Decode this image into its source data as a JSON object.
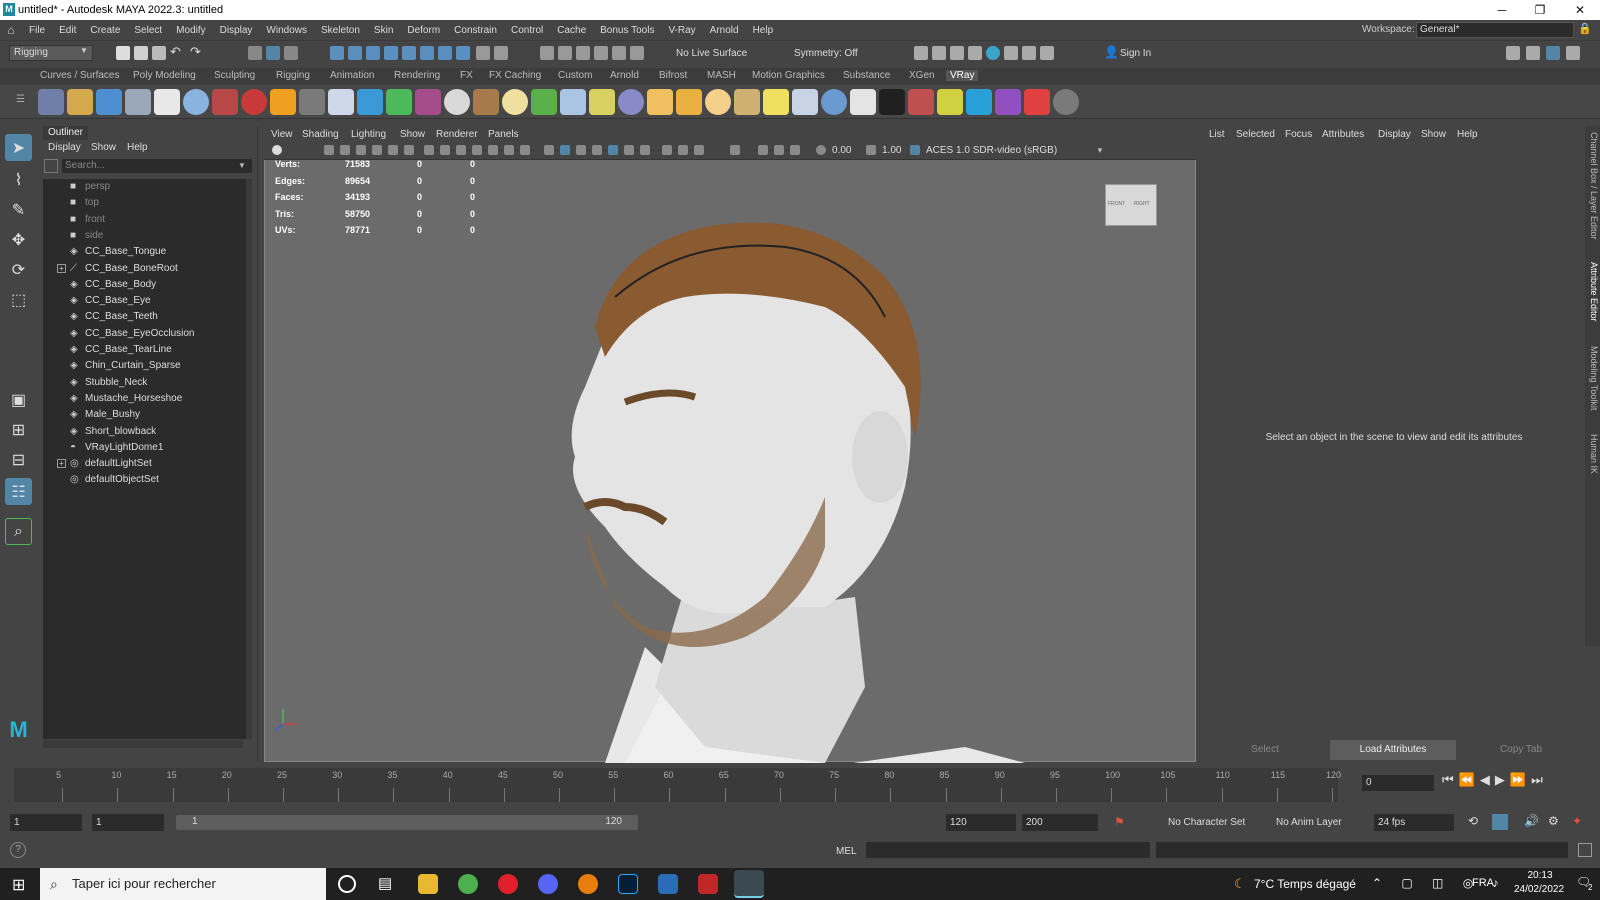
{
  "window": {
    "title": "untitled* - Autodesk MAYA 2022.3: untitled",
    "minimize": "─",
    "maximize": "❐",
    "close": "✕",
    "logo": "M"
  },
  "menubar": {
    "items": [
      "File",
      "Edit",
      "Create",
      "Select",
      "Modify",
      "Display",
      "Windows",
      "Skeleton",
      "Skin",
      "Deform",
      "Constrain",
      "Control",
      "Cache",
      "Bonus Tools",
      "V-Ray",
      "Arnold",
      "Help"
    ],
    "workspace_label": "Workspace:",
    "workspace_value": "General*"
  },
  "statusline": {
    "mode": "Rigging",
    "live_surface": "No Live Surface",
    "symmetry": "Symmetry: Off",
    "sign_in": "Sign In"
  },
  "shelf": {
    "tabs": [
      "Curves / Surfaces",
      "Poly Modeling",
      "Sculpting",
      "Rigging",
      "Animation",
      "Rendering",
      "FX",
      "FX Caching",
      "Custom",
      "Arnold",
      "Bifrost",
      "MASH",
      "Motion Graphics",
      "Substance",
      "XGen",
      "VRay"
    ],
    "active_tab": "VRay"
  },
  "outliner": {
    "title": "Outliner",
    "menu": [
      "Display",
      "Show",
      "Help"
    ],
    "search_placeholder": "Search...",
    "items": [
      {
        "label": "persp",
        "icon": "camera-icon",
        "dim": true
      },
      {
        "label": "top",
        "icon": "camera-icon",
        "dim": true
      },
      {
        "label": "front",
        "icon": "camera-icon",
        "dim": true
      },
      {
        "label": "side",
        "icon": "camera-icon",
        "dim": true
      },
      {
        "label": "CC_Base_Tongue",
        "icon": "mesh-icon"
      },
      {
        "label": "CC_Base_BoneRoot",
        "icon": "joint-icon",
        "expand": true
      },
      {
        "label": "CC_Base_Body",
        "icon": "mesh-icon"
      },
      {
        "label": "CC_Base_Eye",
        "icon": "mesh-icon"
      },
      {
        "label": "CC_Base_Teeth",
        "icon": "mesh-icon"
      },
      {
        "label": "CC_Base_EyeOcclusion",
        "icon": "mesh-icon"
      },
      {
        "label": "CC_Base_TearLine",
        "icon": "mesh-icon"
      },
      {
        "label": "Chin_Curtain_Sparse",
        "icon": "mesh-icon"
      },
      {
        "label": "Stubble_Neck",
        "icon": "mesh-icon"
      },
      {
        "label": "Mustache_Horseshoe",
        "icon": "mesh-icon"
      },
      {
        "label": "Male_Bushy",
        "icon": "mesh-icon"
      },
      {
        "label": "Short_blowback",
        "icon": "mesh-icon"
      },
      {
        "label": "VRayLightDome1",
        "icon": "dome-light-icon"
      },
      {
        "label": "defaultLightSet",
        "icon": "set-icon",
        "expand": true
      },
      {
        "label": "defaultObjectSet",
        "icon": "set-icon"
      }
    ]
  },
  "viewport": {
    "menu": [
      "View",
      "Shading",
      "Lighting",
      "Show",
      "Renderer",
      "Panels"
    ],
    "exposure": "0.00",
    "gamma": "1.00",
    "colorspace": "ACES 1.0 SDR-video (sRGB)",
    "hud": [
      {
        "label": "Verts:",
        "a": "71583",
        "b": "0",
        "c": "0"
      },
      {
        "label": "Edges:",
        "a": "89654",
        "b": "0",
        "c": "0"
      },
      {
        "label": "Faces:",
        "a": "34193",
        "b": "0",
        "c": "0"
      },
      {
        "label": "Tris:",
        "a": "58750",
        "b": "0",
        "c": "0"
      },
      {
        "label": "UVs:",
        "a": "78771",
        "b": "0",
        "c": "0"
      }
    ],
    "viewcube_front": "FRONT",
    "viewcube_right": "RIGHT"
  },
  "attribute_editor": {
    "menu": [
      "List",
      "Selected",
      "Focus",
      "Attributes",
      "Display",
      "Show",
      "Help"
    ],
    "message": "Select an object in the scene to view and edit its attributes",
    "buttons": [
      "Select",
      "Load Attributes",
      "Copy Tab"
    ],
    "side_tabs": [
      "Channel Box / Layer Editor",
      "Attribute Editor",
      "Modeling Toolkit",
      "Human IK"
    ]
  },
  "timeslider": {
    "labels": [
      "5",
      "10",
      "15",
      "20",
      "25",
      "30",
      "35",
      "40",
      "45",
      "50",
      "55",
      "60",
      "65",
      "70",
      "75",
      "80",
      "85",
      "90",
      "95",
      "100",
      "105",
      "110",
      "115",
      "120"
    ],
    "current_frame": "0"
  },
  "rangeslider": {
    "start": "1",
    "start2": "1",
    "range_start": "1",
    "range_end": "120",
    "end": "120",
    "end2": "200",
    "character_set": "No Character Set",
    "anim_layer": "No Anim Layer",
    "fps": "24 fps"
  },
  "commandline": {
    "lang": "MEL"
  },
  "taskbar": {
    "search_placeholder": "Taper ici pour rechercher",
    "weather": "7°C  Temps dégagé",
    "lang": "FRA",
    "time": "20:13",
    "date": "24/02/2022",
    "notifications": "2"
  },
  "colors": {
    "accent": "#5285a6",
    "panel": "#444444",
    "viewport": "#6b6b6b"
  }
}
